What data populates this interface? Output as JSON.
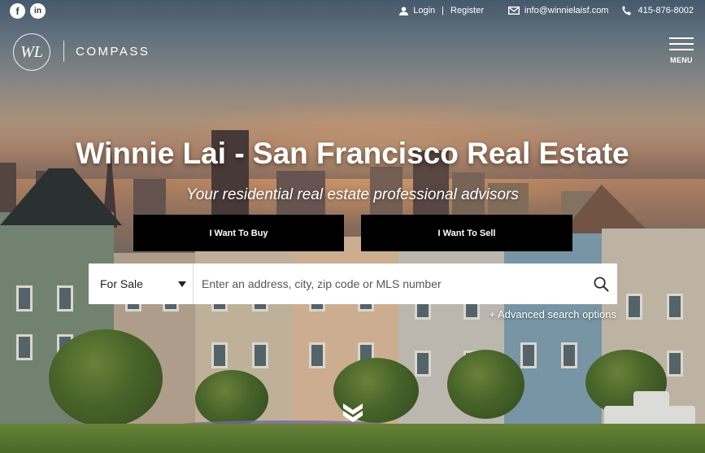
{
  "topbar": {
    "social": [
      {
        "icon": "facebook-icon",
        "glyph": "f"
      },
      {
        "icon": "linkedin-icon",
        "glyph": "in"
      }
    ],
    "login_label": "Login",
    "separator": "|",
    "register_label": "Register",
    "email": "info@winnielaisf.com",
    "phone": "415-876-8002"
  },
  "header": {
    "logo_monogram": "WL",
    "brand": "COMPASS",
    "menu_label": "MENU"
  },
  "hero": {
    "title": "Winnie Lai - San Francisco Real Estate",
    "subtitle": "Your residential real estate professional advisors",
    "buy_label": "I Want To Buy",
    "sell_label": "I Want To Sell"
  },
  "search": {
    "type_selected": "For Sale",
    "placeholder": "Enter an address, city, zip code or MLS number",
    "advanced_label": "+ Advanced search options"
  },
  "colors": {
    "cta_bg": "#000000",
    "text_on_dark": "#ffffff"
  }
}
